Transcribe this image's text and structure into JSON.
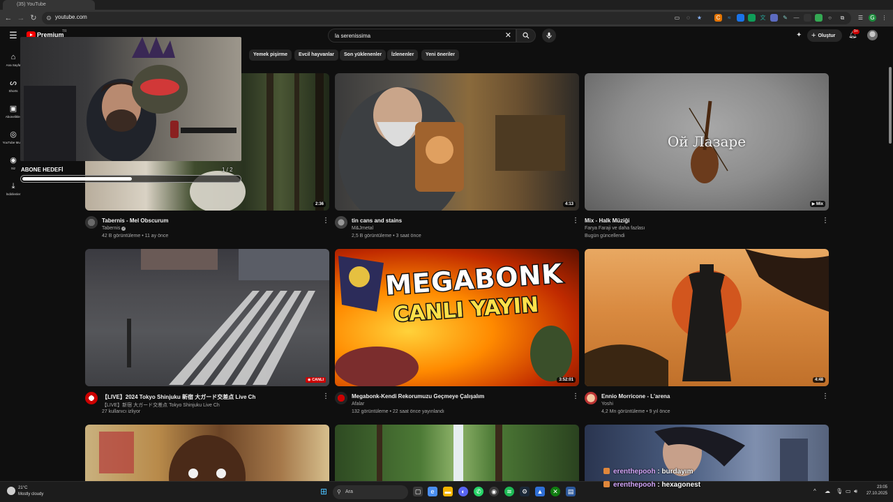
{
  "browser": {
    "tab_title": "(35) YouTube",
    "url": "youtube.com"
  },
  "masthead": {
    "logo_text": "Premium",
    "logo_country": "TR",
    "search_value": "la serenissima",
    "create_label": "Oluştur",
    "notification_count": "9+"
  },
  "guide": {
    "items": [
      {
        "label": "Ana Sayfa",
        "icon": "home-icon"
      },
      {
        "label": "Shorts",
        "icon": "shorts-icon"
      },
      {
        "label": "Abonelikler",
        "icon": "subscriptions-icon"
      },
      {
        "label": "YouTube Music",
        "icon": "music-icon"
      },
      {
        "label": "Siz",
        "icon": "you-icon"
      },
      {
        "label": "İndirilenler",
        "icon": "download-icon"
      }
    ]
  },
  "chips": [
    "Yemek pişirme",
    "Evcil hayvanlar",
    "Son yüklenenler",
    "İzlenenler",
    "Yeni öneriler"
  ],
  "videos": [
    {
      "title": "Tabernis - Mel Obscurum",
      "channel": "Tabernis",
      "verified": true,
      "meta": "42 B görüntüleme • 11 ay önce",
      "duration": "2:36"
    },
    {
      "title": "tin cans and stains",
      "channel": "M&Jmetal",
      "meta": "2,5 B görüntüleme • 3 saat önce",
      "duration": "4:13"
    },
    {
      "title": "Mix - Halk Müziği",
      "channel": "Farya Faraji ve daha fazlası",
      "meta": "Bugün güncellendi",
      "duration": "Mix",
      "thumb_text": "Ой Лазаре"
    },
    {
      "title": "【LIVE】2024 Tokyo Shinjuku 新宿 大ガード交差点 Live Ch",
      "channel": "【LIVE】新宿 大ガード交差点 Tokyo Shinjuku Live Ch",
      "meta": "27 kullanıcı izliyor",
      "badge": "CANLI"
    },
    {
      "title": "Megabonk-Kendi Rekorumuzu Geçmeye Çalışalım",
      "channel": "Afalar",
      "meta": "132 görüntüleme • 22 saat önce yayınlandı",
      "duration": "3:52:01",
      "thumb_line1": "MEGABONK",
      "thumb_line2": "CANLI YAYIN"
    },
    {
      "title": "Ennio Morricone - L'arena",
      "channel": "Yoshi",
      "meta": "4,2 Mn görüntüleme • 9 yıl önce",
      "duration": "4:48"
    }
  ],
  "overlay": {
    "goal_label": "ABONE HEDEFİ",
    "goal_count": "1 / 2",
    "goal_progress": 0.5,
    "chat": [
      {
        "user": "erenthepooh",
        "message": "burdayım"
      },
      {
        "user": "erenthepooh",
        "message": "hexagonest"
      }
    ]
  },
  "taskbar": {
    "temperature": "21°C",
    "weather": "Mostly cloudy",
    "search_placeholder": "Ara",
    "time": "23:05",
    "date": "27.10.2025"
  },
  "colors": {
    "background": "#0f0f0f",
    "chip": "#272727",
    "live_red": "#cc0000",
    "chat_user": "#d7a9ff"
  }
}
